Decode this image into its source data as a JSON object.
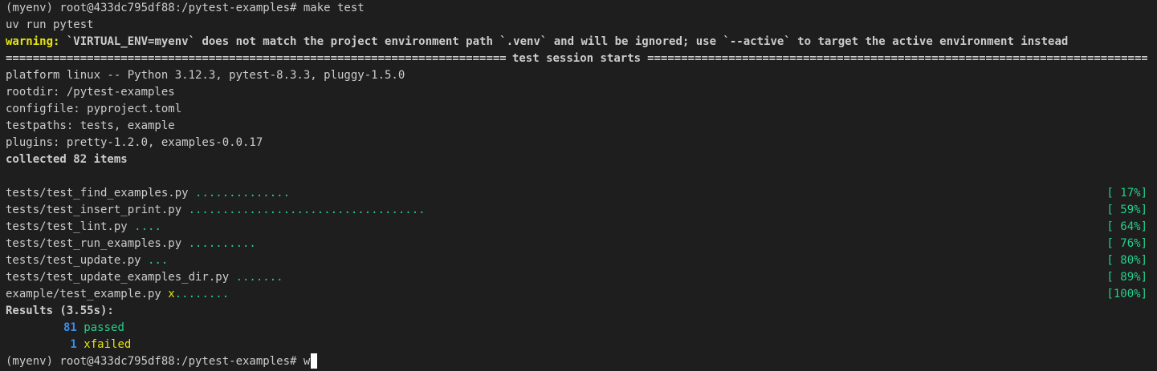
{
  "terminal": {
    "lines": {
      "prompt1": "(myenv) root@433dc795df88:/pytest-examples# make test",
      "uv_run": "uv run pytest",
      "warning_label": "warning:",
      "warning_text": " `VIRTUAL_ENV=myenv` does not match the project environment path `.venv` and will be ignored; use `--active` to target the active environment instead",
      "session_title": "test session starts",
      "platform": "platform linux -- Python 3.12.3, pytest-8.3.3, pluggy-1.5.0",
      "rootdir": "rootdir: /pytest-examples",
      "configfile": "configfile: pyproject.toml",
      "testpaths": "testpaths: tests, example",
      "plugins": "plugins: pretty-1.2.0, examples-0.0.17",
      "collected": "collected 82 items"
    },
    "tests": [
      {
        "file": "tests/test_find_examples.py ",
        "marks": "..............",
        "xmark": "",
        "percent": "[ 17%]"
      },
      {
        "file": "tests/test_insert_print.py ",
        "marks": "...................................",
        "xmark": "",
        "percent": "[ 59%]"
      },
      {
        "file": "tests/test_lint.py ",
        "marks": "....",
        "xmark": "",
        "percent": "[ 64%]"
      },
      {
        "file": "tests/test_run_examples.py ",
        "marks": "..........",
        "xmark": "",
        "percent": "[ 76%]"
      },
      {
        "file": "tests/test_update.py ",
        "marks": "...",
        "xmark": "",
        "percent": "[ 80%]"
      },
      {
        "file": "tests/test_update_examples_dir.py ",
        "marks": ".......",
        "xmark": "",
        "percent": "[ 89%]"
      },
      {
        "file": "example/test_example.py ",
        "marks": "........",
        "xmark": "x",
        "percent": "[100%]"
      }
    ],
    "results": {
      "header": "Results (3.55s):",
      "passed_count": "81",
      "passed_label": "passed",
      "xfailed_count": " 1",
      "xfailed_label": "xfailed"
    },
    "final_prompt": "(myenv) root@433dc795df88:/pytest-examples# ",
    "typed_input": "w",
    "colors": {
      "background": "#1e1e1e",
      "foreground": "#cccccc",
      "green": "#23d18b",
      "yellow": "#e5e510",
      "blue": "#3b8eea"
    }
  }
}
